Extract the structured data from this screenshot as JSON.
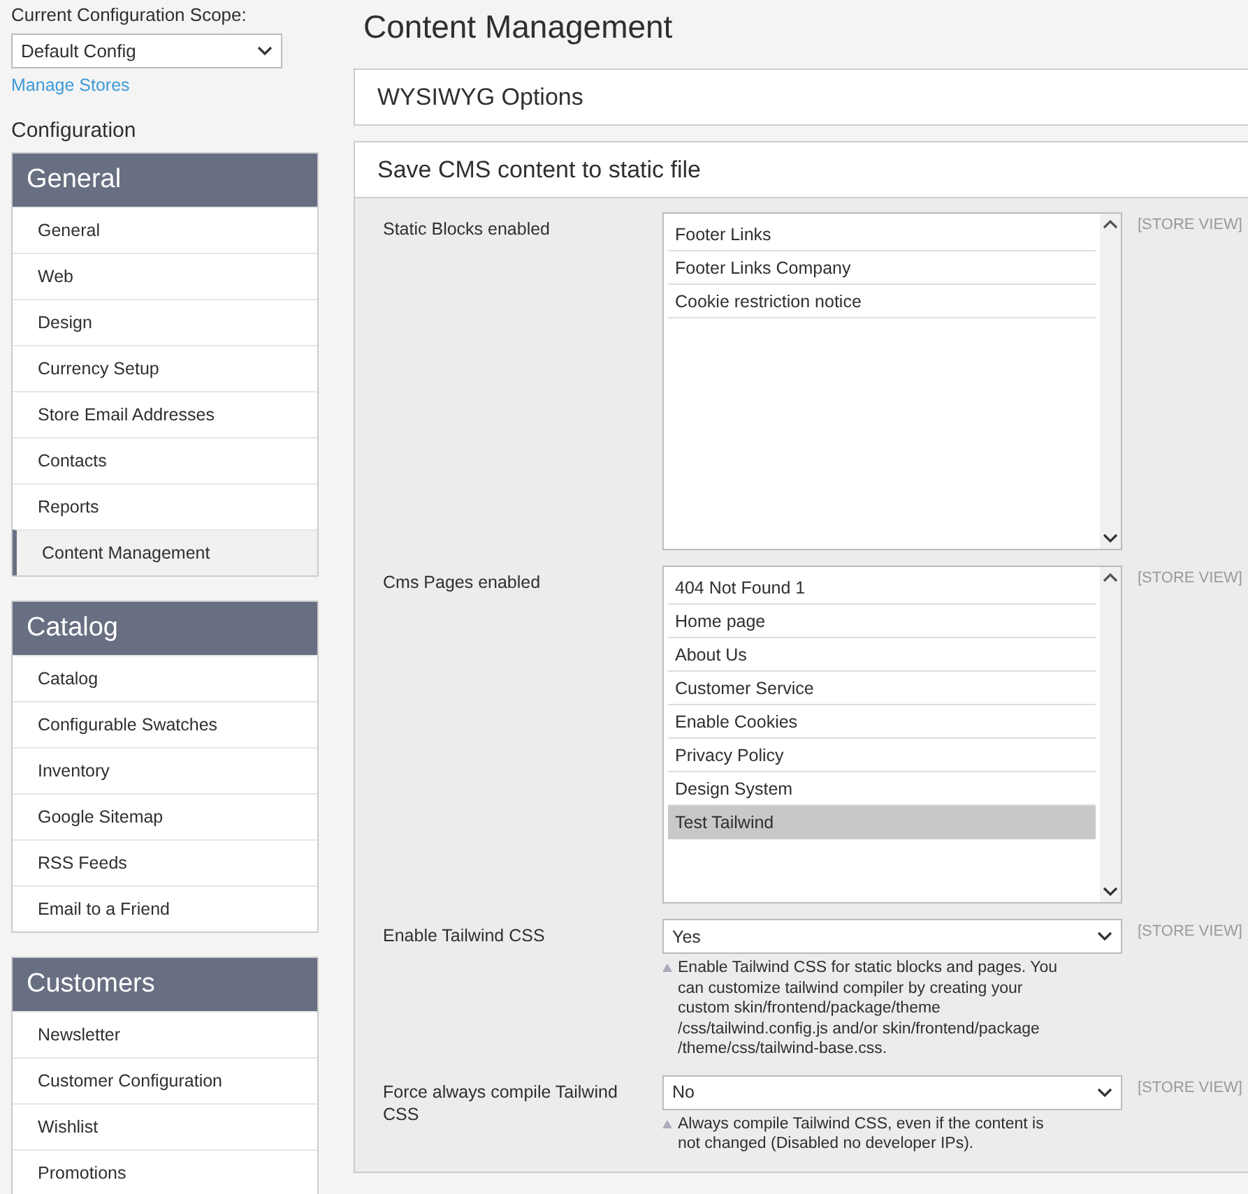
{
  "scope": {
    "label": "Current Configuration Scope:",
    "value": "Default Config",
    "link": "Manage Stores"
  },
  "sidebar": {
    "title": "Configuration",
    "groups": [
      {
        "title": "General",
        "items": [
          {
            "label": "General",
            "selected": false
          },
          {
            "label": "Web",
            "selected": false
          },
          {
            "label": "Design",
            "selected": false
          },
          {
            "label": "Currency Setup",
            "selected": false
          },
          {
            "label": "Store Email Addresses",
            "selected": false
          },
          {
            "label": "Contacts",
            "selected": false
          },
          {
            "label": "Reports",
            "selected": false
          },
          {
            "label": "Content Management",
            "selected": true
          }
        ]
      },
      {
        "title": "Catalog",
        "items": [
          {
            "label": "Catalog",
            "selected": false
          },
          {
            "label": "Configurable Swatches",
            "selected": false
          },
          {
            "label": "Inventory",
            "selected": false
          },
          {
            "label": "Google Sitemap",
            "selected": false
          },
          {
            "label": "RSS Feeds",
            "selected": false
          },
          {
            "label": "Email to a Friend",
            "selected": false
          }
        ]
      },
      {
        "title": "Customers",
        "items": [
          {
            "label": "Newsletter",
            "selected": false
          },
          {
            "label": "Customer Configuration",
            "selected": false
          },
          {
            "label": "Wishlist",
            "selected": false
          },
          {
            "label": "Promotions",
            "selected": false
          }
        ]
      }
    ]
  },
  "page_title": "Content Management",
  "sections": [
    {
      "title": "WYSIWYG Options"
    },
    {
      "title": "Save CMS content to static file",
      "fields": [
        {
          "kind": "multiselect",
          "label": "Static Blocks enabled",
          "scope": "[STORE VIEW]",
          "options": [
            {
              "label": "Footer Links",
              "selected": false
            },
            {
              "label": "Footer Links Company",
              "selected": false
            },
            {
              "label": "Cookie restriction notice",
              "selected": false
            }
          ]
        },
        {
          "kind": "multiselect",
          "label": "Cms Pages enabled",
          "scope": "[STORE VIEW]",
          "options": [
            {
              "label": "404 Not Found 1",
              "selected": false
            },
            {
              "label": "Home page",
              "selected": false
            },
            {
              "label": "About Us",
              "selected": false
            },
            {
              "label": "Customer Service",
              "selected": false
            },
            {
              "label": "Enable Cookies",
              "selected": false
            },
            {
              "label": "Privacy Policy",
              "selected": false
            },
            {
              "label": "Design System",
              "selected": false
            },
            {
              "label": "Test Tailwind",
              "selected": true
            }
          ]
        },
        {
          "kind": "select",
          "label": "Enable Tailwind CSS",
          "scope": "[STORE VIEW]",
          "value": "Yes",
          "note": "Enable Tailwind CSS for static blocks and pages. You can customize tailwind compiler by creating your custom skin/frontend/package/theme /css/tailwind.config.js and/or skin/frontend/package /theme/css/tailwind-base.css."
        },
        {
          "kind": "select",
          "label": "Force always compile Tailwind CSS",
          "scope": "[STORE VIEW]",
          "value": "No",
          "note": "Always compile Tailwind CSS, even if the content is not changed (Disabled no developer IPs)."
        }
      ]
    }
  ]
}
